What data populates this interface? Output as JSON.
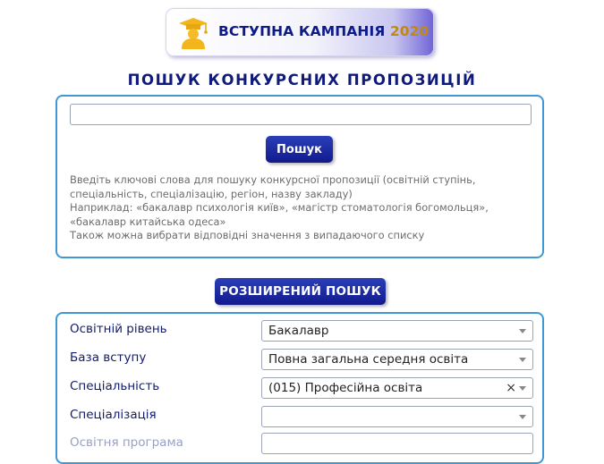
{
  "banner": {
    "text": "ВСТУПНА КАМПАНІЯ",
    "year": "2020",
    "icon": "graduate-icon"
  },
  "page_title": "ПОШУК КОНКУРСНИХ ПРОПОЗИЦІЙ",
  "search": {
    "value": "",
    "button_label": "Пошук",
    "help_lines": [
      "Введіть ключові слова для пошуку конкурсної пропозиції (освітній ступінь, спеціальність, спеціалізацію, регіон, назву закладу)",
      "Наприклад: «бакалавр психологія київ», «магістр стоматологія богомольця», «бакалавр китайська одеса»",
      "Також можна вибрати відповідні значення з випадаючого списку"
    ]
  },
  "advanced": {
    "button_label": "РОЗШИРЕНИЙ ПОШУК",
    "rows": [
      {
        "label": "Освітній рівень",
        "value": "Бакалавр"
      },
      {
        "label": "База вступу",
        "value": "Повна загальна середня освіта"
      },
      {
        "label": "Спеціальність",
        "value": "(015) Професійна освіта",
        "clear": "×"
      },
      {
        "label": "Спеціалізація",
        "value": ""
      },
      {
        "label": "Освітня програма",
        "value": ""
      }
    ]
  },
  "colors": {
    "primary": "#121a8c",
    "accent_year": "#c08a12",
    "panel_border": "#3f98d4"
  }
}
